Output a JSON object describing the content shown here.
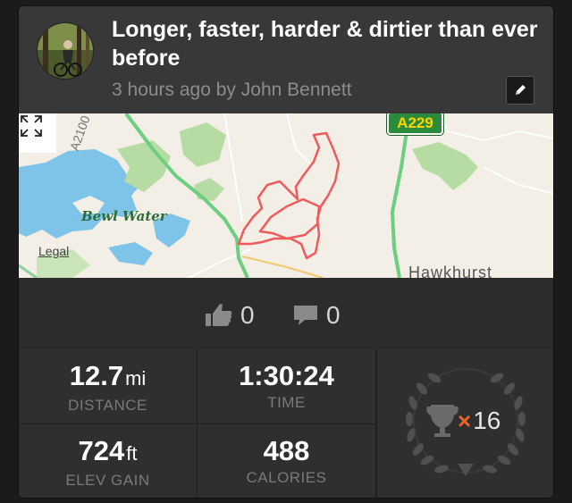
{
  "activity": {
    "title": "Longer, faster, harder & dirtier than ever before",
    "subtitle": "3 hours ago by John Bennett"
  },
  "map": {
    "labels": {
      "water": "Bewl Water",
      "legal": "Legal",
      "road": "A229",
      "road_edge": "A2100",
      "town": "Hawkhurst"
    }
  },
  "social": {
    "kudos_count": "0",
    "comment_count": "0"
  },
  "stats": {
    "distance": {
      "value": "12.7",
      "unit": "mi",
      "label": "DISTANCE"
    },
    "time": {
      "value": "1:30:24",
      "label": "TIME"
    },
    "elevation": {
      "value": "724",
      "unit": "ft",
      "label": "ELEV GAIN"
    },
    "calories": {
      "value": "488",
      "label": "CALORIES"
    }
  },
  "achievements": {
    "multiplier_symbol": "×",
    "count": "16"
  },
  "colors": {
    "route": "#ef5b5b",
    "accent": "#e8642a",
    "road_green": "#6bcf7f",
    "water": "#7ec3e8"
  }
}
